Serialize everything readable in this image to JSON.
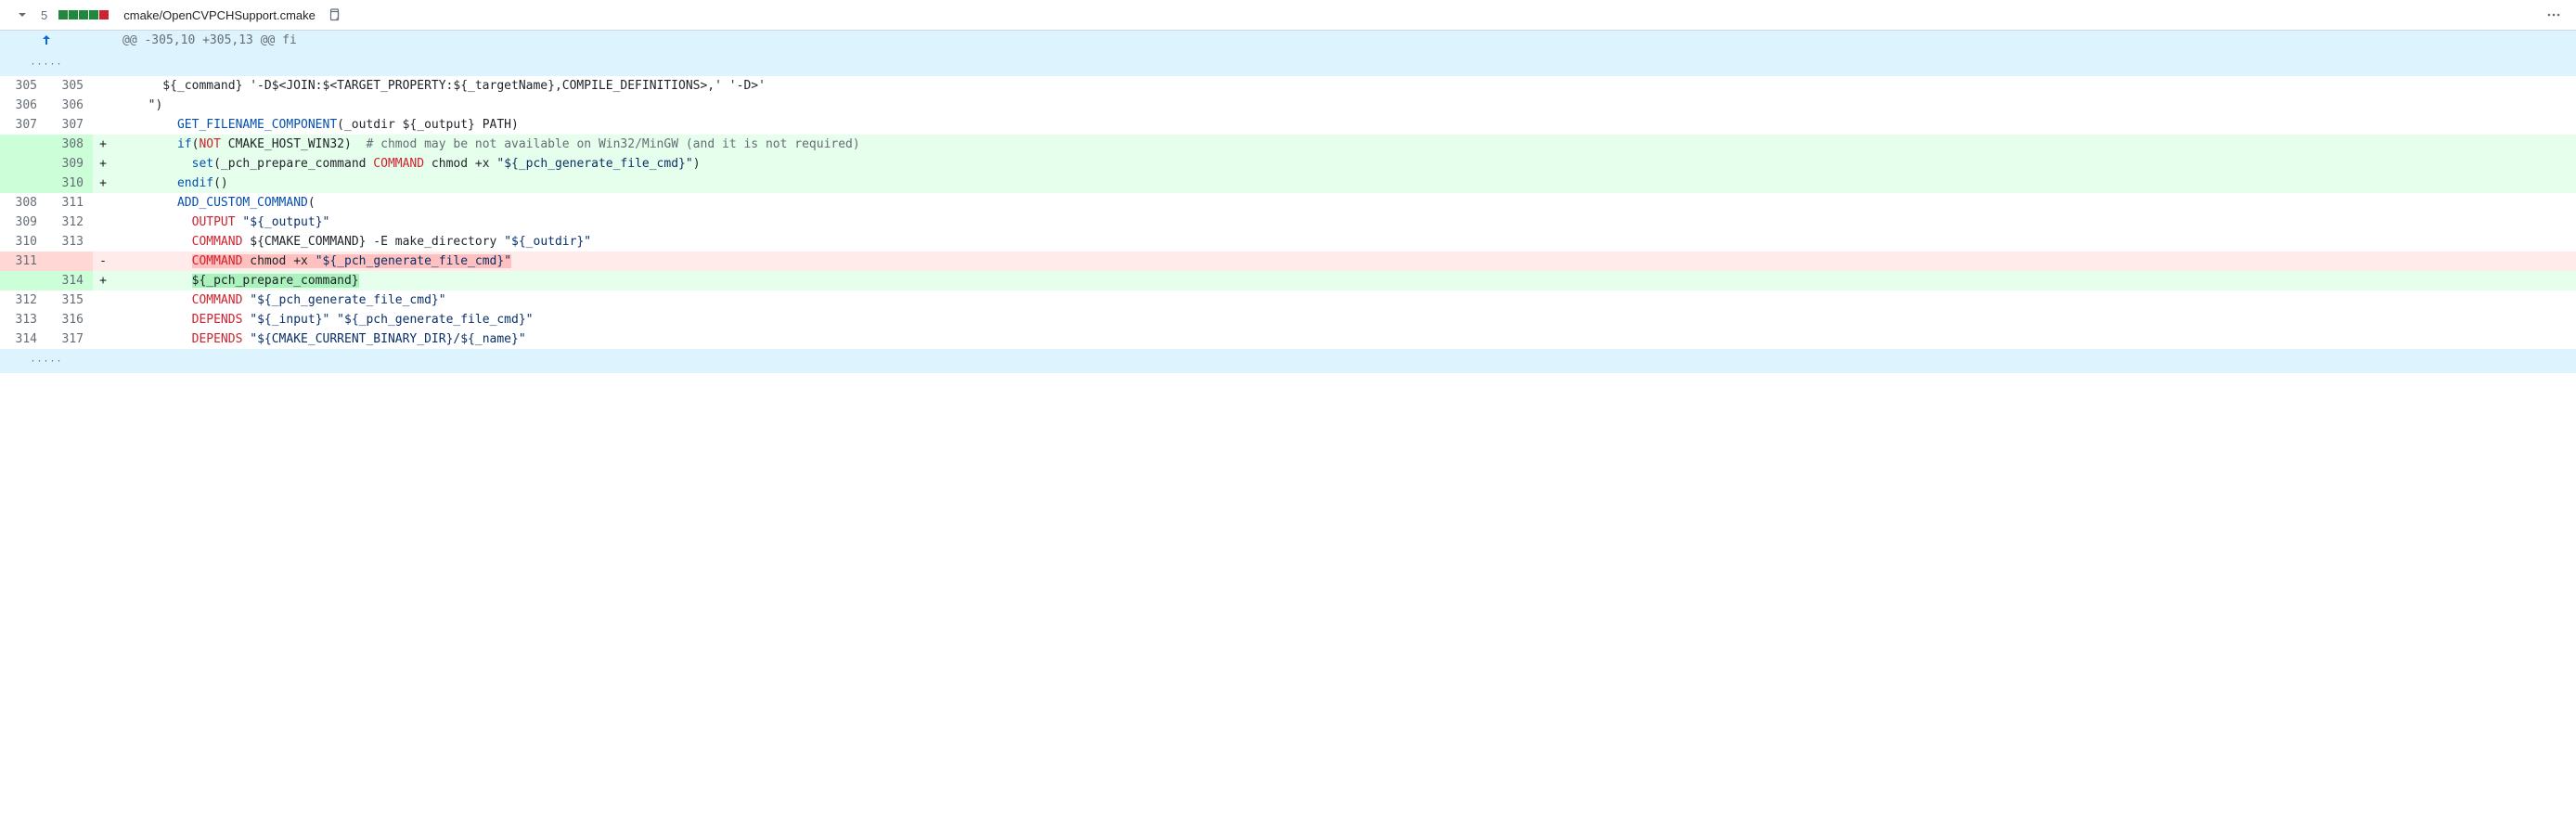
{
  "file_header": {
    "diff_count": "5",
    "filename": "cmake/OpenCVPCHSupport.cmake"
  },
  "hunk_header": "@@ -305,10 +305,13 @@ fi",
  "lines": [
    {
      "old": "305",
      "new": "305",
      "marker": "",
      "type": "ctx",
      "segments": [
        {
          "t": "    ${_command} '-D$<JOIN:$<TARGET_PROPERTY:${_targetName},COMPILE_DEFINITIONS>,' '-D>'"
        }
      ]
    },
    {
      "old": "306",
      "new": "306",
      "marker": "",
      "type": "ctx",
      "segments": [
        {
          "t": "  \")"
        }
      ]
    },
    {
      "old": "307",
      "new": "307",
      "marker": "",
      "type": "ctx",
      "segments": [
        {
          "t": "      "
        },
        {
          "c": "tok-fn",
          "t": "GET_FILENAME_COMPONENT"
        },
        {
          "t": "(_outdir ${_output} PATH)"
        }
      ]
    },
    {
      "old": "",
      "new": "308",
      "marker": "+",
      "type": "add",
      "segments": [
        {
          "t": "      "
        },
        {
          "c": "tok-fn",
          "t": "if"
        },
        {
          "t": "("
        },
        {
          "c": "tok-k",
          "t": "NOT"
        },
        {
          "t": " CMAKE_HOST_WIN32)  "
        },
        {
          "c": "tok-cmt",
          "t": "# chmod may be not available on Win32/MinGW (and it is not required)"
        }
      ]
    },
    {
      "old": "",
      "new": "309",
      "marker": "+",
      "type": "add",
      "segments": [
        {
          "t": "        "
        },
        {
          "c": "tok-fn",
          "t": "set"
        },
        {
          "t": "(_pch_prepare_command "
        },
        {
          "c": "tok-k",
          "t": "COMMAND"
        },
        {
          "t": " chmod +x "
        },
        {
          "c": "tok-s",
          "t": "\"${_pch_generate_file_cmd}\""
        },
        {
          "t": ")"
        }
      ]
    },
    {
      "old": "",
      "new": "310",
      "marker": "+",
      "type": "add",
      "segments": [
        {
          "t": "      "
        },
        {
          "c": "tok-fn",
          "t": "endif"
        },
        {
          "t": "()"
        }
      ]
    },
    {
      "old": "308",
      "new": "311",
      "marker": "",
      "type": "ctx",
      "segments": [
        {
          "t": "      "
        },
        {
          "c": "tok-fn",
          "t": "ADD_CUSTOM_COMMAND"
        },
        {
          "t": "("
        }
      ]
    },
    {
      "old": "309",
      "new": "312",
      "marker": "",
      "type": "ctx",
      "segments": [
        {
          "t": "        "
        },
        {
          "c": "tok-k",
          "t": "OUTPUT"
        },
        {
          "t": " "
        },
        {
          "c": "tok-s",
          "t": "\"${_output}\""
        }
      ]
    },
    {
      "old": "310",
      "new": "313",
      "marker": "",
      "type": "ctx",
      "segments": [
        {
          "t": "        "
        },
        {
          "c": "tok-k",
          "t": "COMMAND"
        },
        {
          "t": " ${CMAKE_COMMAND} -E make_directory "
        },
        {
          "c": "tok-s",
          "t": "\"${_outdir}\""
        }
      ]
    },
    {
      "old": "311",
      "new": "",
      "marker": "-",
      "type": "del",
      "segments": [
        {
          "t": "        "
        },
        {
          "c": "hl-del",
          "inner": [
            {
              "c": "tok-k",
              "t": "COMMAND"
            },
            {
              "t": " chmod +x "
            },
            {
              "c": "tok-s",
              "t": "\"${_pch_generate_file_cmd}\""
            }
          ]
        }
      ]
    },
    {
      "old": "",
      "new": "314",
      "marker": "+",
      "type": "add",
      "segments": [
        {
          "t": "        "
        },
        {
          "c": "hl-add",
          "t": "${_pch_prepare_command}"
        }
      ]
    },
    {
      "old": "312",
      "new": "315",
      "marker": "",
      "type": "ctx",
      "segments": [
        {
          "t": "        "
        },
        {
          "c": "tok-k",
          "t": "COMMAND"
        },
        {
          "t": " "
        },
        {
          "c": "tok-s",
          "t": "\"${_pch_generate_file_cmd}\""
        }
      ]
    },
    {
      "old": "313",
      "new": "316",
      "marker": "",
      "type": "ctx",
      "segments": [
        {
          "t": "        "
        },
        {
          "c": "tok-k",
          "t": "DEPENDS"
        },
        {
          "t": " "
        },
        {
          "c": "tok-s",
          "t": "\"${_input}\""
        },
        {
          "t": " "
        },
        {
          "c": "tok-s",
          "t": "\"${_pch_generate_file_cmd}\""
        }
      ]
    },
    {
      "old": "314",
      "new": "317",
      "marker": "",
      "type": "ctx",
      "segments": [
        {
          "t": "        "
        },
        {
          "c": "tok-k",
          "t": "DEPENDS"
        },
        {
          "t": " "
        },
        {
          "c": "tok-s",
          "t": "\"${CMAKE_CURRENT_BINARY_DIR}/${_name}\""
        }
      ]
    }
  ]
}
